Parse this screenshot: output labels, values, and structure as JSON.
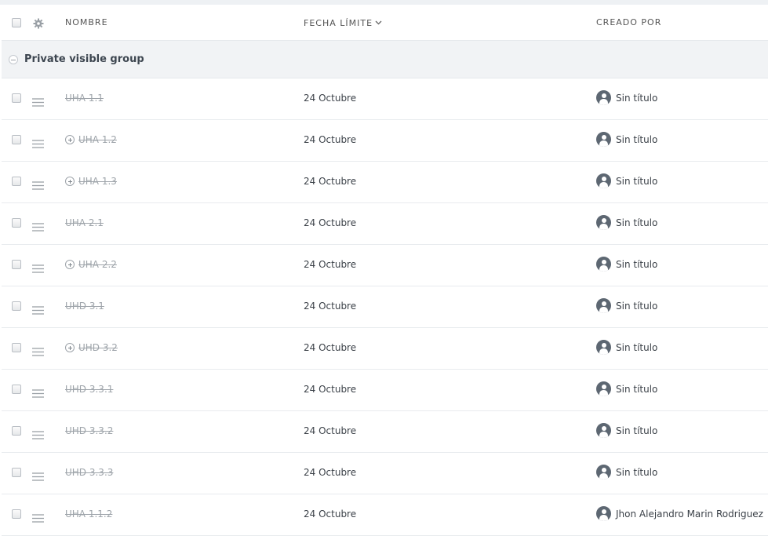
{
  "header": {
    "name_label": "NOMBRE",
    "due_label": "FECHA LÍMITE",
    "creator_label": "CREADO POR"
  },
  "group": {
    "title": "Private visible group"
  },
  "rows": [
    {
      "name": "UHA 1.1",
      "due": "24 Octubre",
      "creator": "Sin título",
      "has_children": false
    },
    {
      "name": "UHA 1.2",
      "due": "24 Octubre",
      "creator": "Sin título",
      "has_children": true
    },
    {
      "name": "UHA 1.3",
      "due": "24 Octubre",
      "creator": "Sin título",
      "has_children": true
    },
    {
      "name": "UHA 2.1",
      "due": "24 Octubre",
      "creator": "Sin título",
      "has_children": false
    },
    {
      "name": "UHA 2.2",
      "due": "24 Octubre",
      "creator": "Sin título",
      "has_children": true
    },
    {
      "name": "UHD 3.1",
      "due": "24 Octubre",
      "creator": "Sin título",
      "has_children": false
    },
    {
      "name": "UHD 3.2",
      "due": "24 Octubre",
      "creator": "Sin título",
      "has_children": true
    },
    {
      "name": "UHD 3.3.1",
      "due": "24 Octubre",
      "creator": "Sin título",
      "has_children": false
    },
    {
      "name": "UHD 3.3.2",
      "due": "24 Octubre",
      "creator": "Sin título",
      "has_children": false
    },
    {
      "name": "UHD 3.3.3",
      "due": "24 Octubre",
      "creator": "Sin título",
      "has_children": false
    },
    {
      "name": "UHA 1.1.2",
      "due": "24 Octubre",
      "creator": "Jhon Alejandro Marin Rodriguez",
      "has_children": false
    }
  ],
  "icons": {
    "select_all": "checkbox-icon",
    "settings": "gear-icon",
    "sort": "chevron-down-icon",
    "collapse": "minus-circle-icon",
    "drag": "drag-handle-icon",
    "expand": "plus-circle-icon",
    "avatar": "user-avatar-icon"
  }
}
